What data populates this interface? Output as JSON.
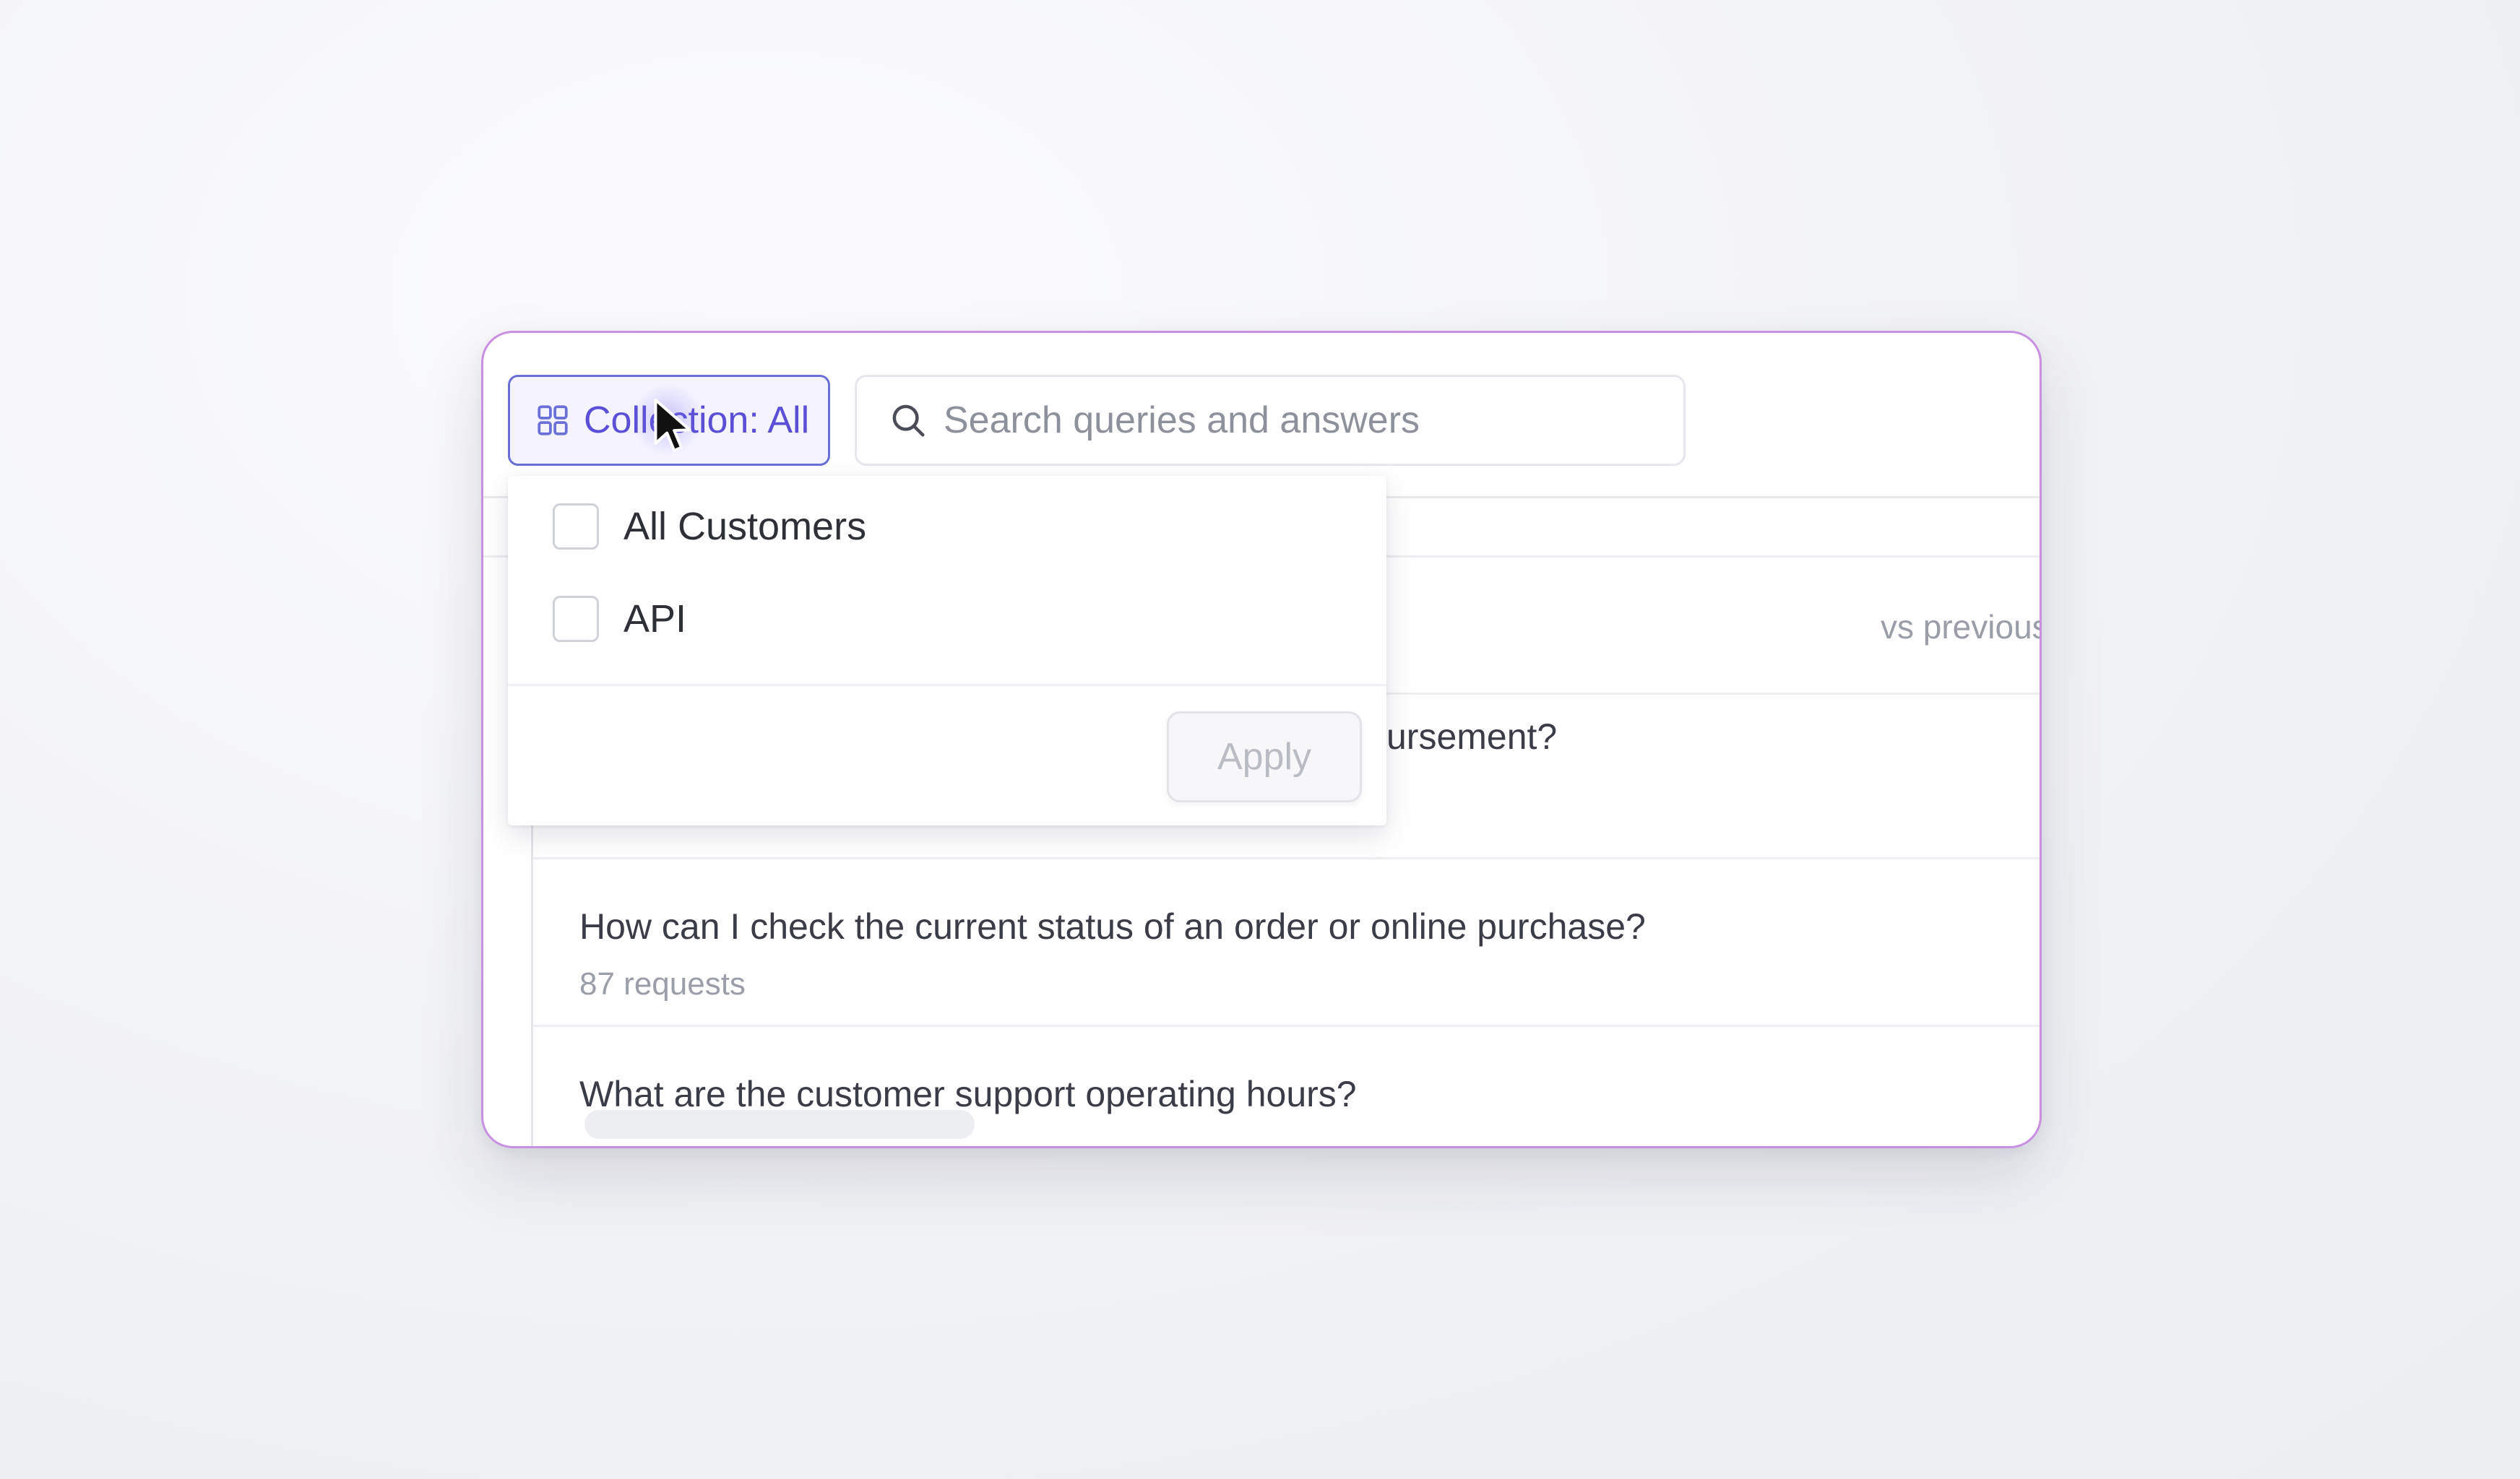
{
  "toolbar": {
    "collection_label": "Collection: All",
    "search_placeholder": "Search queries and answers"
  },
  "table": {
    "vs_previous_label": "vs previous"
  },
  "rows": [
    {
      "question_partial": "ursement?"
    },
    {
      "question": "How can I check the current status of an order or online purchase?",
      "meta": "87 requests"
    },
    {
      "question": "What are the customer support operating hours?"
    }
  ],
  "dropdown": {
    "options": [
      {
        "label": "All Customers",
        "checked": false
      },
      {
        "label": "API",
        "checked": false
      }
    ],
    "apply_label": "Apply"
  },
  "colors": {
    "accent": "#5a4fd6",
    "frame_border": "#c98fe0"
  }
}
